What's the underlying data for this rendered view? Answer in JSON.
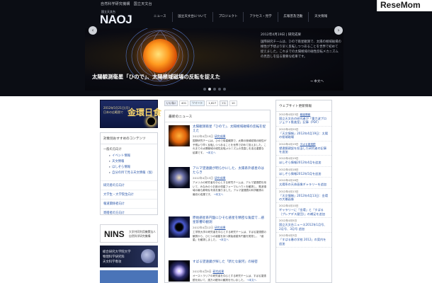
{
  "header": {
    "org_top": "自然科学研究機構　国立天文台",
    "logo_sub": "国立天文台",
    "logo_text": "NAOJ",
    "watermark": "ReseMom",
    "nav": [
      "ニュース",
      "国立天文台について",
      "プロジェクト",
      "アクセス・見学",
      "広報普及活動",
      "天文情報"
    ]
  },
  "hero": {
    "date_line": "2012年4月19日 | 研究成果",
    "desc_lines": [
      "国際研究チームは、ひので衛星観測で、太陽の極域磁場の",
      "極性が予想より早く反転しつつあることを世界で初めて",
      "捉えました。これまでの太陽極域の磁性反転メカニズム",
      "の見直しを迫る重要な結果です。"
    ],
    "caption": "太陽観測衛星「ひので」、太陽極域磁場の反転を捉えた",
    "more": "→ 本文へ",
    "arrow_left": "‹",
    "arrow_right": "›",
    "active_dot": 1,
    "dot_count": 5
  },
  "left": {
    "banner_line1": "2012年5月21日(月)",
    "banner_line2": "日本の広範囲で",
    "banner_big": "金環日食",
    "panel_title": "対象別おすすめのコンテンツ",
    "group_label": "一般の方向け",
    "sub_links": [
      "イベント情報",
      "天文情報",
      "ほしぞら情報",
      "自分の目で見る天文情報（仮）"
    ],
    "rows": [
      "研究者の方向け",
      "大学生・大学院生向け",
      "報道関係者向け",
      "寄贈者の方向け"
    ],
    "nins_big": "NINS",
    "nins_sub1": "大学共同利用機関法人",
    "nins_sub2": "自然科学研究機構",
    "grad_line1": "総合研究大学院大学",
    "grad_line2": "物理科学研究科",
    "grad_line3": "天文科学専攻"
  },
  "social": {
    "like_label": "いいね!",
    "like_count": "401",
    "tweet_label": "ツイート",
    "tweet_count": "1,627",
    "gplus_label": "+1",
    "gplus_count": "10"
  },
  "news": {
    "header": "最新のニュース",
    "items": [
      {
        "title": "太陽観測衛星「ひので」、太陽極域磁場の反転を捉えた",
        "date": "2012年4月19日",
        "category": "研究成果",
        "body": "国際研究チームは、ひので衛星観測で、太陽の極域磁場の極性が予想より早く反転しつつあることを世界で初めて捉えました。これまでの太陽極域の磁性反転メカニズムの見直しを迫る重要な結果です。",
        "more": "→本文へ"
      },
      {
        "title": "アルマ望遠鏡が明らかにした、太陽系外惑星のはたらき",
        "date": "2012年4月13日",
        "category": "研究成果",
        "body": "アメリカの研究者を中心とする研究チームは、アルマ望遠鏡を用いて、みなみのうお座の恒星フォーマルハウトを観測し、電波領域の最も鮮明な写真を撮りました。アルマ望遠鏡の科学観測の最初の成果です。",
        "more": "→本文へ"
      },
      {
        "title": "原始惑星系円盤にひそむ惑星を精密な角度で…惑星影響の観測",
        "date": "2012年4月12日",
        "category": "研究成果",
        "body": "工学院大学の研究者を中心とする研究チームは、すばる望遠鏡の観測から、ひとつの惑星を持つ原始惑星系円盤を発見し、「惑星」を観測しました。",
        "more": "→本文へ"
      },
      {
        "title": "すばる望遠鏡が探した「新たな銀河」の秘密",
        "date": "2012年4月9日",
        "category": "研究成果",
        "body": "オーストラリアの研究者を中心とする研究チームは、すばる望遠鏡を用いて、遠方の銀河の観測を行いました。",
        "more": "→本文へ"
      }
    ]
  },
  "update": {
    "header": "ウェブサイト更新情報",
    "items": [
      {
        "date": "2012年4月23日",
        "cat": "報道情報",
        "text": "国立天文台の研究者が「重力波プロジェクト推進室」記事（PDF）"
      },
      {
        "date": "2012年4月20日",
        "cat": "",
        "text": "「天文情報」2012年4月19日：太陽の極域磁場"
      },
      {
        "date": "2012年4月19日",
        "cat": "すばる望遠鏡",
        "text": "望遠鏡建設を担当した研究者の記事を追加"
      },
      {
        "date": "2012年4月19日",
        "cat": "",
        "text": "ほしぞら情報2012年4月を追加"
      },
      {
        "date": "2012年4月18日",
        "cat": "",
        "text": "ほしぞら情報2012年5月を追加"
      },
      {
        "date": "2012年4月16日",
        "cat": "",
        "text": "太陽系の天体画像ギャラリーを追加"
      },
      {
        "date": "2012年4月13日",
        "cat": "",
        "text": "「天文情報」2012年4月13日：金環の大橋画像"
      },
      {
        "date": "2012年4月10日",
        "cat": "",
        "text": "ギャラリーに「金環」と「すばる（プレアデス星団）」の補足を追加"
      },
      {
        "date": "2012年4月5日",
        "cat": "",
        "text": "国立天文台ニュース2012年1月号、2月号、3月号 追加"
      },
      {
        "date": "2012年4月3日",
        "cat": "",
        "text": "「すばる春の学校 2012」の案内を追加"
      }
    ]
  }
}
